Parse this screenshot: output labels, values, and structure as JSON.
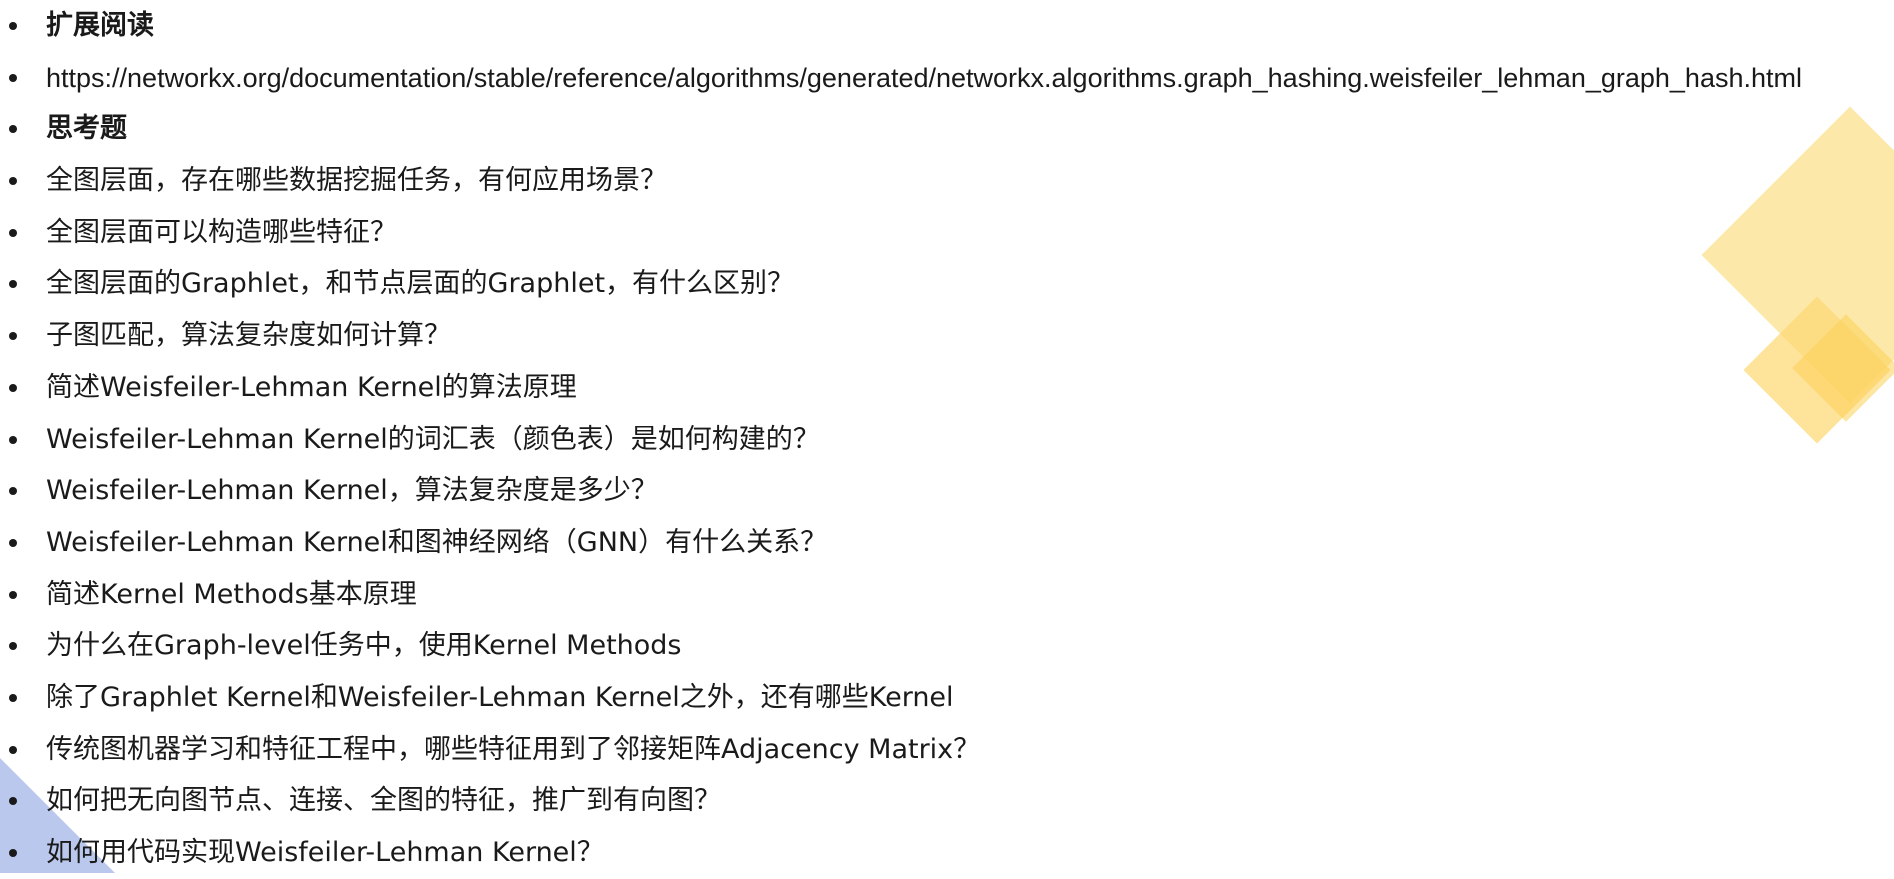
{
  "items": [
    {
      "text": "扩展阅读",
      "bold": true
    },
    {
      "text": "https://networkx.org/documentation/stable/reference/algorithms/generated/networkx.algorithms.graph_hashing.weisfeiler_lehman_graph_hash.html",
      "bold": false
    },
    {
      "text": "思考题",
      "bold": true
    },
    {
      "text": "全图层面，存在哪些数据挖掘任务，有何应用场景？",
      "bold": false
    },
    {
      "text": "全图层面可以构造哪些特征？",
      "bold": false
    },
    {
      "text": "全图层面的Graphlet，和节点层面的Graphlet，有什么区别？",
      "bold": false
    },
    {
      "text": "子图匹配，算法复杂度如何计算？",
      "bold": false
    },
    {
      "text": "简述Weisfeiler-Lehman Kernel的算法原理",
      "bold": false
    },
    {
      "text": "Weisfeiler-Lehman Kernel的词汇表（颜色表）是如何构建的？",
      "bold": false
    },
    {
      "text": "Weisfeiler-Lehman Kernel，算法复杂度是多少？",
      "bold": false
    },
    {
      "text": "Weisfeiler-Lehman Kernel和图神经网络（GNN）有什么关系？",
      "bold": false
    },
    {
      "text": "简述Kernel Methods基本原理",
      "bold": false
    },
    {
      "text": "为什么在Graph-level任务中，使用Kernel Methods",
      "bold": false
    },
    {
      "text": "除了Graphlet Kernel和Weisfeiler-Lehman Kernel之外，还有哪些Kernel",
      "bold": false
    },
    {
      "text": "传统图机器学习和特征工程中，哪些特征用到了邻接矩阵Adjacency Matrix？",
      "bold": false
    },
    {
      "text": "如何把无向图节点、连接、全图的特征，推广到有向图？",
      "bold": false
    },
    {
      "text": "如何用代码实现Weisfeiler-Lehman Kernel？",
      "bold": false
    }
  ],
  "colors": {
    "text": "#1a1a1a",
    "decoration_yellow": "#fce49a",
    "decoration_yellow_dark": "#fbcf55",
    "decoration_blue": "#b9c8ec"
  }
}
